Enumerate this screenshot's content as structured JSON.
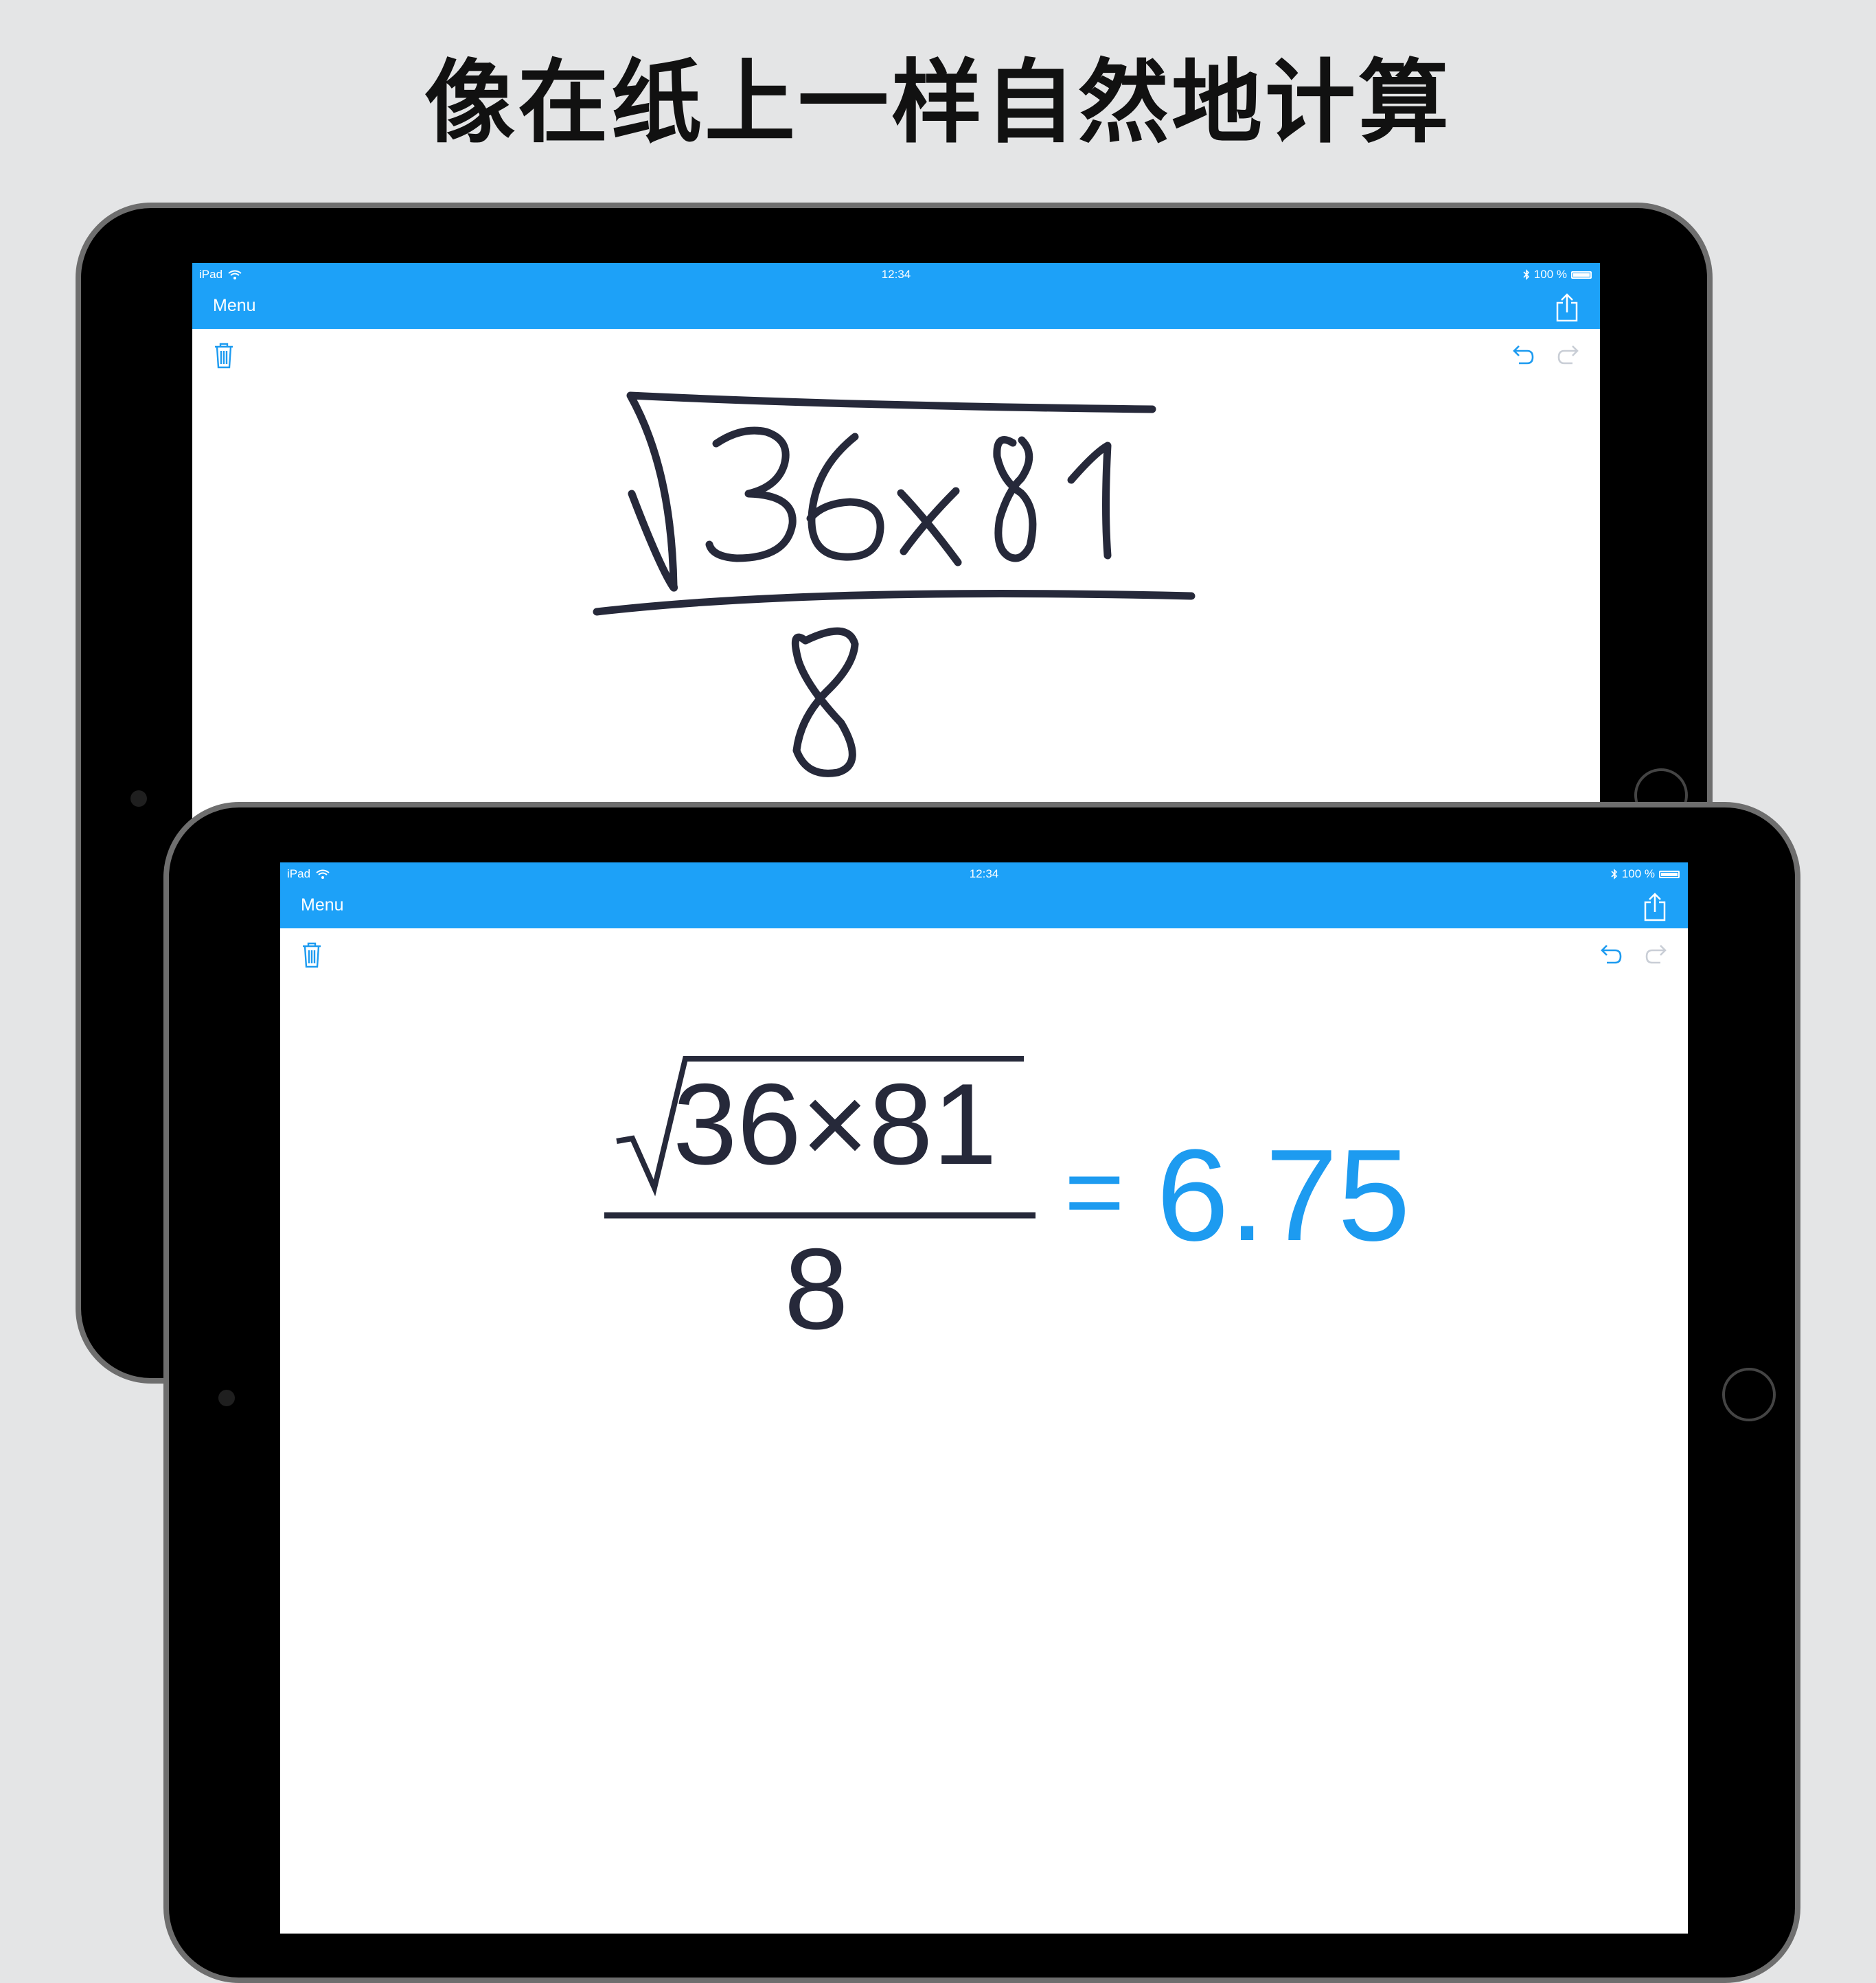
{
  "headline": "像在纸上一样自然地计算",
  "status_bar": {
    "device": "iPad",
    "time": "12:34",
    "battery": "100 %",
    "battery_level": 1.0
  },
  "nav_bar": {
    "menu_label": "Menu"
  },
  "expression": {
    "radicand": "36×81",
    "denominator": "8",
    "equals": "=",
    "result": "6.75"
  },
  "colors": {
    "accent": "#1da1f8",
    "ink": "#26293a",
    "result": "#1d9bf0"
  },
  "icons": {
    "trash": "trash-icon",
    "undo": "undo-icon",
    "redo": "redo-icon",
    "share": "share-icon",
    "wifi": "wifi-icon",
    "bluetooth": "bluetooth-icon",
    "battery": "battery-icon"
  }
}
